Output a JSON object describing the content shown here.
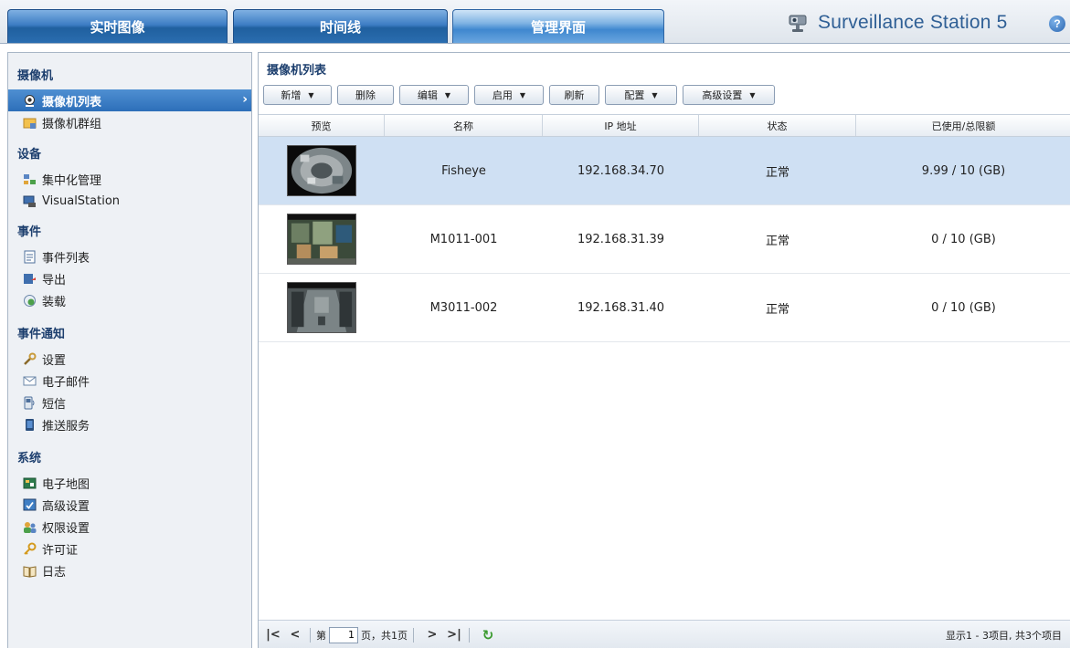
{
  "tabs": {
    "live": "实时图像",
    "timeline": "时间线",
    "manage": "管理界面"
  },
  "brand": {
    "title": "Surveillance Station 5",
    "help": "?"
  },
  "sidebar": {
    "sections": [
      {
        "title": "摄像机",
        "items": [
          {
            "label": "摄像机列表",
            "icon": "camera-list-icon",
            "selected": true
          },
          {
            "label": "摄像机群组",
            "icon": "camera-group-icon"
          }
        ]
      },
      {
        "title": "设备",
        "items": [
          {
            "label": "集中化管理",
            "icon": "central-management-icon"
          },
          {
            "label": "VisualStation",
            "icon": "visualstation-icon"
          }
        ]
      },
      {
        "title": "事件",
        "items": [
          {
            "label": "事件列表",
            "icon": "event-list-icon"
          },
          {
            "label": "导出",
            "icon": "export-icon"
          },
          {
            "label": "装载",
            "icon": "mount-icon"
          }
        ]
      },
      {
        "title": "事件通知",
        "items": [
          {
            "label": "设置",
            "icon": "wrench-icon"
          },
          {
            "label": "电子邮件",
            "icon": "email-icon"
          },
          {
            "label": "短信",
            "icon": "sms-icon"
          },
          {
            "label": "推送服务",
            "icon": "push-service-icon"
          }
        ]
      },
      {
        "title": "系统",
        "items": [
          {
            "label": "电子地图",
            "icon": "emap-icon"
          },
          {
            "label": "高级设置",
            "icon": "advanced-settings-icon"
          },
          {
            "label": "权限设置",
            "icon": "privilege-icon"
          },
          {
            "label": "许可证",
            "icon": "license-key-icon"
          },
          {
            "label": "日志",
            "icon": "log-book-icon"
          }
        ]
      }
    ]
  },
  "main": {
    "title": "摄像机列表",
    "toolbar": {
      "add": "新增",
      "delete": "删除",
      "edit": "编辑",
      "enable": "启用",
      "refresh": "刷新",
      "config": "配置",
      "advanced": "高级设置"
    },
    "columns": {
      "preview": "预览",
      "name": "名称",
      "ip": "IP 地址",
      "status": "状态",
      "usage": "已使用/总限额"
    },
    "rows": [
      {
        "name": "Fisheye",
        "ip": "192.168.34.70",
        "status": "正常",
        "usage": "9.99 / 10 (GB)",
        "selected": true
      },
      {
        "name": "M1011-001",
        "ip": "192.168.31.39",
        "status": "正常",
        "usage": "0 / 10 (GB)"
      },
      {
        "name": "M3011-002",
        "ip": "192.168.31.40",
        "status": "正常",
        "usage": "0 / 10 (GB)"
      }
    ],
    "pager": {
      "page_prefix": "第",
      "page_value": "1",
      "page_suffix": "页，共1页",
      "info": "显示1 - 3项目, 共3个项目"
    }
  },
  "colors": {
    "tab_blue": "#2a6db0",
    "selection_blue": "#2d6fb9",
    "row_selected": "#cfe0f3",
    "brand_text": "#2f5f95",
    "refresh_green": "#3a9a2e"
  }
}
